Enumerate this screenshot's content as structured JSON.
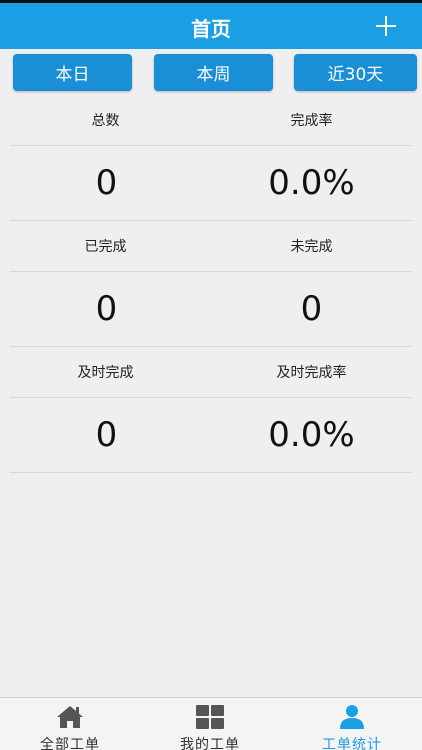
{
  "header": {
    "title": "首页"
  },
  "tabs": [
    {
      "label": "本日"
    },
    {
      "label": "本周"
    },
    {
      "label": "近30天"
    }
  ],
  "stats": [
    {
      "label_left": "总数",
      "label_right": "完成率",
      "value_left": "0",
      "value_right": "0.0%"
    },
    {
      "label_left": "已完成",
      "label_right": "未完成",
      "value_left": "0",
      "value_right": "0"
    },
    {
      "label_left": "及时完成",
      "label_right": "及时完成率",
      "value_left": "0",
      "value_right": "0.0%"
    }
  ],
  "nav": [
    {
      "label": "全部工单",
      "icon": "home-icon"
    },
    {
      "label": "我的工单",
      "icon": "grid-icon"
    },
    {
      "label": "工单统计",
      "icon": "user-icon",
      "active": true
    }
  ],
  "colors": {
    "accent": "#1a9ee4",
    "tab_bg": "#1a8fd6",
    "background": "#efefef"
  }
}
